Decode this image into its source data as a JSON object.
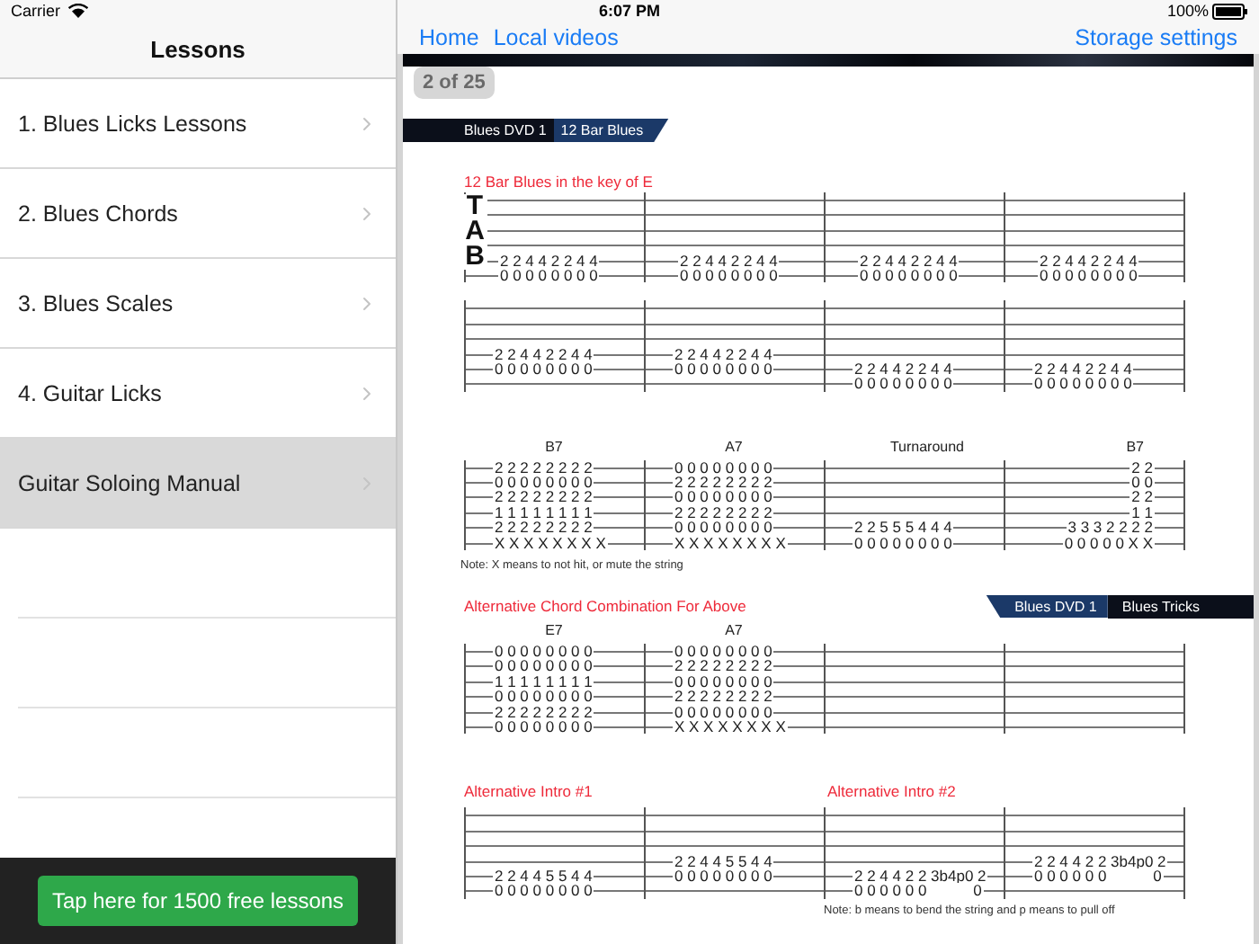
{
  "status_bar": {
    "carrier": "Carrier",
    "time": "6:07 PM",
    "battery": "100%"
  },
  "sidebar": {
    "title": "Lessons",
    "items": [
      {
        "label": "1. Blues Licks Lessons",
        "selected": false
      },
      {
        "label": "2. Blues Chords",
        "selected": false
      },
      {
        "label": "3. Blues Scales",
        "selected": false
      },
      {
        "label": "4. Guitar Licks",
        "selected": false
      },
      {
        "label": "Guitar Soloing Manual",
        "selected": true
      }
    ],
    "promo_button": "Tap here for 1500 free lessons"
  },
  "nav": {
    "links": [
      "Home",
      "Local videos"
    ],
    "right_link": "Storage settings"
  },
  "page_badge": "2 of 25",
  "document": {
    "tab_clef": [
      "T",
      "A",
      "B"
    ],
    "blocks": [
      {
        "kind": "banner",
        "right_aligned": false,
        "segments": [
          "Blues DVD 1",
          "12 Bar Blues"
        ]
      },
      {
        "kind": "heading",
        "texts": [
          "12 Bar Blues in the key of E"
        ]
      },
      {
        "kind": "staff",
        "clef": true,
        "measures": [
          {
            "string_5": "2 2 4 4 2 2 4 4",
            "string_6": "0 0 0 0 0 0 0 0"
          },
          {
            "string_5": "2 2 4 4 2 2 4 4",
            "string_6": "0 0 0 0 0 0 0 0"
          },
          {
            "string_5": "2 2 4 4 2 2 4 4",
            "string_6": "0 0 0 0 0 0 0 0"
          },
          {
            "string_5": "2 2 4 4 2 2 4 4",
            "string_6": "0 0 0 0 0 0 0 0"
          }
        ]
      },
      {
        "kind": "staff",
        "clef": false,
        "measures": [
          {
            "string_4": "2 2 4 4 2 2 4 4",
            "string_5": "0 0 0 0 0 0 0 0"
          },
          {
            "string_4": "2 2 4 4 2 2 4 4",
            "string_5": "0 0 0 0 0 0 0 0"
          },
          {
            "string_5": "2 2 4 4 2 2 4 4",
            "string_6": "0 0 0 0 0 0 0 0"
          },
          {
            "string_5": "2 2 4 4 2 2 4 4",
            "string_6": "0 0 0 0 0 0 0 0"
          }
        ]
      },
      {
        "kind": "staff",
        "clef": false,
        "measures": [
          {
            "chord": "B7",
            "chord_at_end": false,
            "right_aligned": false,
            "string_1": "2 2 2 2 2 2 2 2",
            "string_2": "0 0 0 0 0 0 0 0",
            "string_3": "2 2 2 2 2 2 2 2",
            "string_4": "1 1 1 1 1 1 1 1",
            "string_5": "2 2 2 2 2 2 2 2",
            "string_6": "X X X X X X X X"
          },
          {
            "chord": "A7",
            "chord_at_end": false,
            "right_aligned": false,
            "string_1": "0 0 0 0 0 0 0 0",
            "string_2": "2 2 2 2 2 2 2 2",
            "string_3": "0 0 0 0 0 0 0 0",
            "string_4": "2 2 2 2 2 2 2 2",
            "string_5": "0 0 0 0 0 0 0 0",
            "string_6": "X X X X X X X X"
          },
          {
            "chord": "Turnaround",
            "chord_at_end": true,
            "right_aligned": false,
            "string_5": "2 2 5 5 5 4 4 4",
            "string_6": "0 0 0 0 0 0 0 0"
          },
          {
            "chord": "B7",
            "chord_at_end": true,
            "right_aligned": true,
            "string_1": "2 2",
            "string_2": "0 0",
            "string_3": "2 2",
            "string_4": "1 1",
            "string_5": "3 3 3 2 2 2 2",
            "string_6": "0 0 0 0 0 X X"
          }
        ]
      },
      {
        "kind": "note",
        "indented": false,
        "text": "Note: X means to not hit, or mute the string"
      },
      {
        "kind": "heading_banner",
        "texts": [
          "Alternative Chord Combination For Above"
        ],
        "right_aligned": true,
        "segments": [
          "Blues DVD 1",
          "Blues Tricks"
        ]
      },
      {
        "kind": "staff",
        "clef": false,
        "measures": [
          {
            "chord": "E7",
            "chord_at_end": false,
            "string_1": "0 0 0 0 0 0 0 0",
            "string_2": "0 0 0 0 0 0 0 0",
            "string_3": "1 1 1 1 1 1 1 1",
            "string_4": "0 0 0 0 0 0 0 0",
            "string_5": "2 2 2 2 2 2 2 2",
            "string_6": "0 0 0 0 0 0 0 0"
          },
          {
            "chord": "A7",
            "chord_at_end": false,
            "string_1": "0 0 0 0 0 0 0 0",
            "string_2": "2 2 2 2 2 2 2 2",
            "string_3": "0 0 0 0 0 0 0 0",
            "string_4": "2 2 2 2 2 2 2 2",
            "string_5": "0 0 0 0 0 0 0 0",
            "string_6": "X X X X X X X X"
          }
        ]
      },
      {
        "kind": "heading",
        "texts": [
          "Alternative Intro #1",
          "Alternative Intro #2"
        ]
      },
      {
        "kind": "staff",
        "clef": false,
        "measures": [
          {
            "string_5": "2 2 4 4 5 5 4 4",
            "string_6": "0 0 0 0 0 0 0 0"
          },
          {
            "string_4": "2 2 4 4 5 5 4 4",
            "string_5": "0 0 0 0 0 0 0 0"
          },
          {
            "string_5": "2 2 4 4 2 2 3b4p0 2",
            "string_6": "0 0 0 0 0 0           0"
          },
          {
            "string_4": "2 2 4 4 2 2 3b4p0 2",
            "string_5": "0 0 0 0 0 0           0"
          }
        ]
      },
      {
        "kind": "note",
        "indented": true,
        "text": "Note: b means to bend the string and p means to pull off"
      }
    ]
  }
}
